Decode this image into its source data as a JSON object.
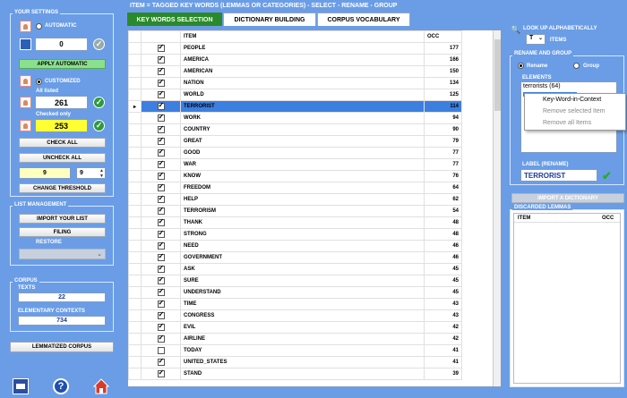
{
  "top_title": "ITEM = TAGGED KEY WORDS (LEMMAS OR CATEGORIES) - SELECT - RENAME - GROUP",
  "tabs": [
    "KEY WORDS SELECTION",
    "DICTIONARY BUILDING",
    "CORPUS VOCABULARY"
  ],
  "settings": {
    "title": "YOUR SETTINGS",
    "automatic_label": "AUTOMATIC",
    "automatic_value": "0",
    "apply_automatic": "APPLY AUTOMATIC",
    "customized_label": "CUSTOMIZED",
    "all_listed_label": "All listed",
    "all_listed_value": "261",
    "checked_only_label": "Checked only",
    "checked_only_value": "253",
    "check_all": "CHECK ALL",
    "uncheck_all": "UNCHECK ALL",
    "threshold_left": "9",
    "threshold_right": "9",
    "change_threshold": "CHANGE THRESHOLD"
  },
  "list_management": {
    "title": "LIST MANAGEMENT",
    "import": "IMPORT YOUR LIST",
    "filing": "FILING",
    "restore": "RESTORE"
  },
  "corpus": {
    "title": "CORPUS",
    "texts_label": "TEXTS",
    "texts_value": "22",
    "contexts_label": "ELEMENTARY CONTEXTS",
    "contexts_value": "734",
    "lemmatized": "LEMMATIZED CORPUS"
  },
  "grid": {
    "headers": [
      "ITEM",
      "OCC"
    ],
    "rows": [
      {
        "item": "PEOPLE",
        "occ": "177",
        "checked": true
      },
      {
        "item": "AMERICA",
        "occ": "166",
        "checked": true
      },
      {
        "item": "AMERICAN",
        "occ": "150",
        "checked": true
      },
      {
        "item": "NATION",
        "occ": "134",
        "checked": true
      },
      {
        "item": "WORLD",
        "occ": "125",
        "checked": true
      },
      {
        "item": "TERRORIST",
        "occ": "114",
        "checked": true,
        "selected": true
      },
      {
        "item": "WORK",
        "occ": "94",
        "checked": true
      },
      {
        "item": "COUNTRY",
        "occ": "90",
        "checked": true
      },
      {
        "item": "GREAT",
        "occ": "79",
        "checked": true
      },
      {
        "item": "GOOD",
        "occ": "77",
        "checked": true
      },
      {
        "item": "WAR",
        "occ": "77",
        "checked": true
      },
      {
        "item": "KNOW",
        "occ": "76",
        "checked": true
      },
      {
        "item": "FREEDOM",
        "occ": "64",
        "checked": true
      },
      {
        "item": "HELP",
        "occ": "62",
        "checked": true
      },
      {
        "item": "TERRORISM",
        "occ": "54",
        "checked": true
      },
      {
        "item": "THANK",
        "occ": "48",
        "checked": true
      },
      {
        "item": "STRONG",
        "occ": "48",
        "checked": true
      },
      {
        "item": "NEED",
        "occ": "46",
        "checked": true
      },
      {
        "item": "GOVERNMENT",
        "occ": "46",
        "checked": true
      },
      {
        "item": "ASK",
        "occ": "45",
        "checked": true
      },
      {
        "item": "SURE",
        "occ": "45",
        "checked": true
      },
      {
        "item": "UNDERSTAND",
        "occ": "45",
        "checked": true
      },
      {
        "item": "TIME",
        "occ": "43",
        "checked": true
      },
      {
        "item": "CONGRESS",
        "occ": "43",
        "checked": true
      },
      {
        "item": "EVIL",
        "occ": "42",
        "checked": true
      },
      {
        "item": "AIRLINE",
        "occ": "42",
        "checked": true
      },
      {
        "item": "TODAY",
        "occ": "41",
        "checked": false
      },
      {
        "item": "UNITED_STATES",
        "occ": "41",
        "checked": true
      },
      {
        "item": "STAND",
        "occ": "39",
        "checked": true
      }
    ]
  },
  "right": {
    "lookup_label": "LOOK UP ALPHABETICALLY",
    "letter": "T",
    "items_label": "ITEMS",
    "rename_group_title": "RENAME AND GROUP",
    "rename_label": "Rename",
    "group_label": "Group",
    "elements_label": "ELEMENTS",
    "element_item": "terrorists (64)",
    "label_rename_title": "LABEL (RENAME)",
    "label_value": "TERRORIST",
    "import_dictionary": "IMPORT A DICTIONARY",
    "discarded_title": "DISCARDED LEMMAS",
    "discarded_headers": [
      "ITEM",
      "OCC"
    ]
  },
  "context_menu": [
    "Key-Word-in-Context",
    "Remove selected Item",
    "Remove all Items"
  ],
  "colors": {
    "background": "#6a9de6",
    "selected_row": "#3d7fe0",
    "active_tab": "#2a8a2a",
    "highlight_field": "#ffff33"
  }
}
